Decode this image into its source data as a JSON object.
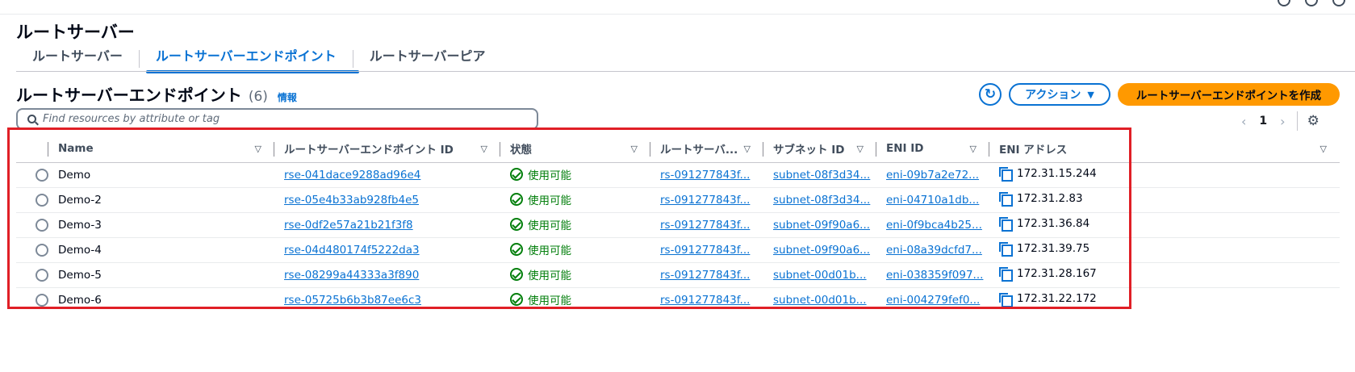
{
  "page": {
    "title": "ルートサーバー"
  },
  "tabs": [
    {
      "label": "ルートサーバー"
    },
    {
      "label": "ルートサーバーエンドポイント"
    },
    {
      "label": "ルートサーバーピア"
    }
  ],
  "section": {
    "title": "ルートサーバーエンドポイント",
    "count": "(6)",
    "info_link": "情報"
  },
  "toolbar": {
    "refresh_icon": "refresh-icon",
    "action_label": "アクション",
    "create_label": "ルートサーバーエンドポイントを作成"
  },
  "search": {
    "placeholder": "Find resources by attribute or tag"
  },
  "pagination": {
    "current_page": "1"
  },
  "table": {
    "columns": [
      "Name",
      "ルートサーバーエンドポイント ID",
      "状態",
      "ルートサーバ...",
      "サブネット ID",
      "ENI ID",
      "ENI アドレス"
    ],
    "rows": [
      {
        "name": "Demo",
        "endpoint_id": "rse-041dace9288ad96e4",
        "status": "使用可能",
        "route_server": "rs-091277843f...",
        "subnet": "subnet-08f3d34...",
        "eni_id": "eni-09b7a2e72...",
        "eni_address": "172.31.15.244"
      },
      {
        "name": "Demo-2",
        "endpoint_id": "rse-05e4b33ab928fb4e5",
        "status": "使用可能",
        "route_server": "rs-091277843f...",
        "subnet": "subnet-08f3d34...",
        "eni_id": "eni-04710a1db...",
        "eni_address": "172.31.2.83"
      },
      {
        "name": "Demo-3",
        "endpoint_id": "rse-0df2e57a21b21f3f8",
        "status": "使用可能",
        "route_server": "rs-091277843f...",
        "subnet": "subnet-09f90a6...",
        "eni_id": "eni-0f9bca4b25...",
        "eni_address": "172.31.36.84"
      },
      {
        "name": "Demo-4",
        "endpoint_id": "rse-04d480174f5222da3",
        "status": "使用可能",
        "route_server": "rs-091277843f...",
        "subnet": "subnet-09f90a6...",
        "eni_id": "eni-08a39dcfd7...",
        "eni_address": "172.31.39.75"
      },
      {
        "name": "Demo-5",
        "endpoint_id": "rse-08299a44333a3f890",
        "status": "使用可能",
        "route_server": "rs-091277843f...",
        "subnet": "subnet-00d01b...",
        "eni_id": "eni-038359f097...",
        "eni_address": "172.31.28.167"
      },
      {
        "name": "Demo-6",
        "endpoint_id": "rse-05725b6b3b87ee6c3",
        "status": "使用可能",
        "route_server": "rs-091277843f...",
        "subnet": "subnet-00d01b...",
        "eni_id": "eni-004279fef0...",
        "eni_address": "172.31.22.172"
      }
    ]
  },
  "colors": {
    "link": "#0972d3",
    "primary_button": "#ff9900",
    "status_ok": "#037f0c",
    "highlight": "#e01f26"
  }
}
